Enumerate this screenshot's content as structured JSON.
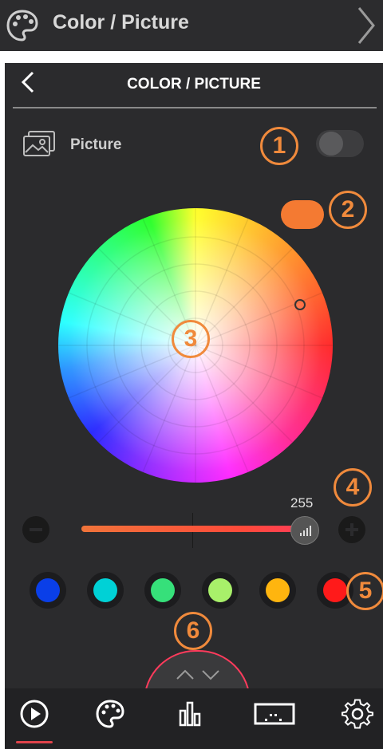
{
  "top_bar": {
    "title": "Color / Picture",
    "icon": "palette-icon",
    "chevron": "chevron-right-icon"
  },
  "header": {
    "title": "COLOR / PICTURE",
    "back_icon": "back-arrow-icon"
  },
  "picture": {
    "label": "Picture",
    "icon": "image-icon",
    "toggle_on": false
  },
  "callouts": [
    "1",
    "2",
    "3",
    "4",
    "5",
    "6"
  ],
  "color_wheel": {
    "selected_color": "#ff8a00",
    "pill_color": "#f47a32"
  },
  "brightness": {
    "value": "255",
    "level": 1.0
  },
  "swatches": [
    "#0a3fe8",
    "#00d1d6",
    "#36e07a",
    "#a8f06a",
    "#ffb50f",
    "#ff1a1a"
  ],
  "nav": {
    "items": [
      "play-icon",
      "palette-icon",
      "equalizer-icon",
      "scene-icon",
      "settings-icon"
    ],
    "active_index": 0
  },
  "colors": {
    "accent": "#f08a3c",
    "background": "#2b2b2d",
    "highlight": "#e0434a"
  }
}
